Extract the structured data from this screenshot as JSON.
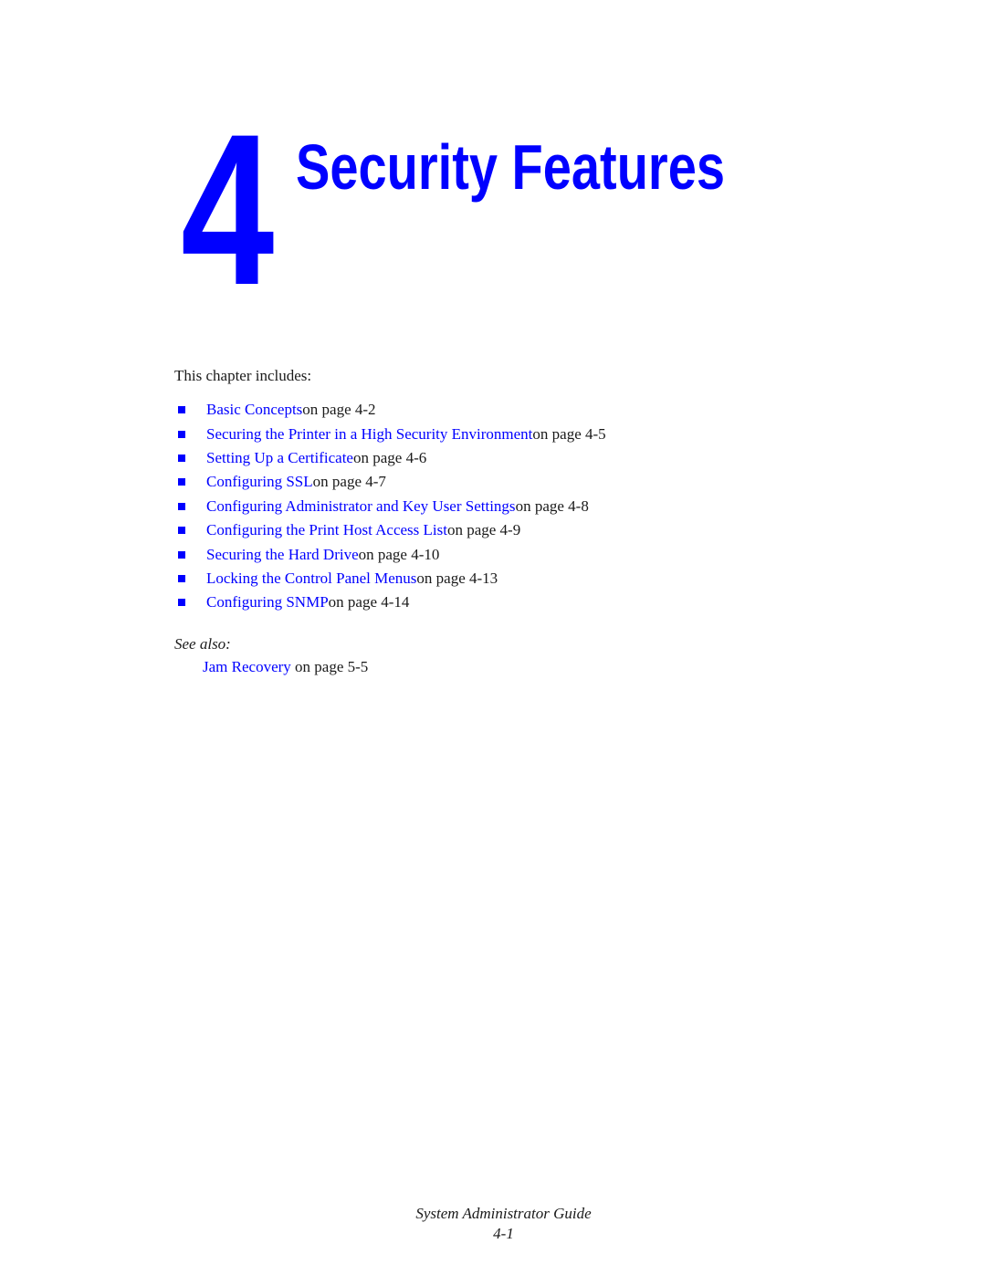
{
  "chapter": {
    "number": "4",
    "title": "Security Features",
    "accent_color": "#0000ff"
  },
  "intro": "This chapter includes:",
  "toc": [
    {
      "link": "Basic Concepts",
      "suffix": " on page 4-2"
    },
    {
      "link": "Securing the Printer in a High Security Environment",
      "suffix": " on page 4-5"
    },
    {
      "link": "Setting Up a Certificate",
      "suffix": " on page 4-6"
    },
    {
      "link": "Configuring SSL",
      "suffix": " on page 4-7"
    },
    {
      "link": "Configuring Administrator and Key User Settings",
      "suffix": " on page 4-8"
    },
    {
      "link": "Configuring the Print Host Access List",
      "suffix": " on page 4-9"
    },
    {
      "link": "Securing the Hard Drive",
      "suffix": " on page 4-10"
    },
    {
      "link": "Locking the Control Panel Menus",
      "suffix": " on page 4-13"
    },
    {
      "link": "Configuring SNMP",
      "suffix": " on page 4-14"
    }
  ],
  "see_also": {
    "label": "See also:",
    "items": [
      {
        "link": "Jam Recovery",
        "suffix": " on page 5-5"
      }
    ]
  },
  "footer": {
    "guide_title": "System Administrator Guide",
    "page_number": "4-1"
  }
}
